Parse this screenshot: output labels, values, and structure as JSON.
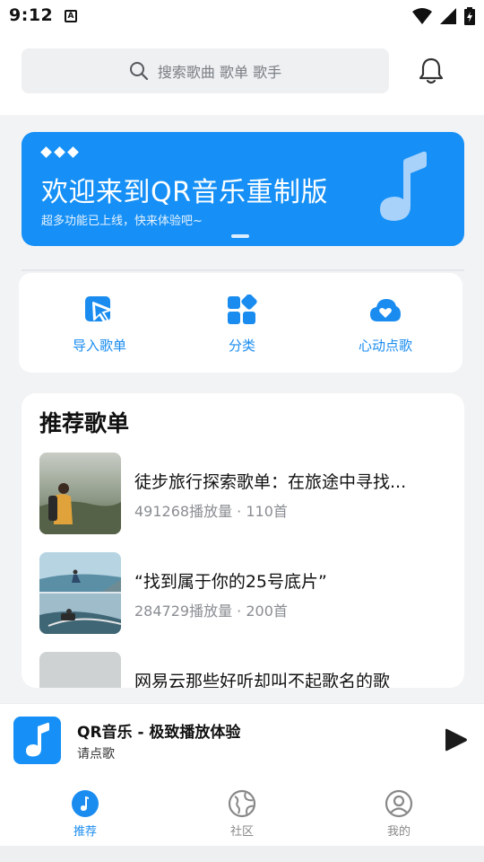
{
  "status_bar": {
    "time": "9:12",
    "a_badge": "A"
  },
  "search": {
    "placeholder": "搜索歌曲 歌单 歌手"
  },
  "banner": {
    "title": "欢迎来到QR音乐重制版",
    "subtitle": "超多功能已上线，快来体验吧~",
    "color": "#1690f6"
  },
  "quick_actions": [
    {
      "label": "导入歌单",
      "icon": "import-playlist-icon"
    },
    {
      "label": "分类",
      "icon": "category-grid-icon"
    },
    {
      "label": "心动点歌",
      "icon": "heart-cloud-icon"
    }
  ],
  "recommend": {
    "title": "推荐歌单",
    "playlists": [
      {
        "name": "徒步旅行探索歌单：在旅途中寻找...",
        "meta": "491268播放量 · 110首"
      },
      {
        "name": "“找到属于你的25号底片”",
        "meta": "284729播放量 · 200首"
      },
      {
        "name": "网易云那些好听却叫不起歌名的歌",
        "meta": ""
      }
    ]
  },
  "player": {
    "title": "QR音乐 - 极致播放体验",
    "subtitle": "请点歌"
  },
  "tabs": [
    {
      "label": "推荐",
      "active": true
    },
    {
      "label": "社区",
      "active": false
    },
    {
      "label": "我的",
      "active": false
    }
  ],
  "colors": {
    "accent": "#1a8cf0",
    "background": "#f2f3f5"
  }
}
